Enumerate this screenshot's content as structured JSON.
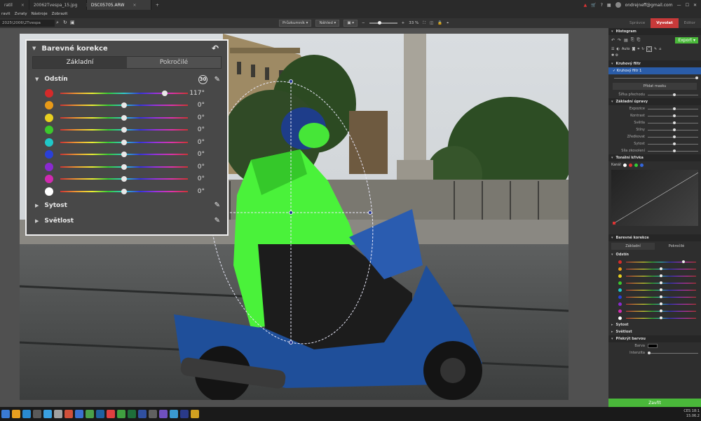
{
  "tabs": [
    {
      "label": "ratil",
      "active": false
    },
    {
      "label": "20062Tvespa_15.jpg",
      "active": false
    },
    {
      "label": "DSC05705.ARW",
      "active": true
    }
  ],
  "user": {
    "email": "ondrejneff@gmail.com"
  },
  "menu": [
    "ravit",
    "Zvraty",
    "Nástroje",
    "Zobrazit"
  ],
  "path": "2025\\2006\\2Tvespa",
  "center_tools": {
    "explorer": "Průzkumník",
    "preview": "Náhled",
    "zoom": "33 %"
  },
  "modes": [
    {
      "label": "Správce",
      "active": false
    },
    {
      "label": "Vyvolat",
      "active": true
    },
    {
      "label": "Editor",
      "active": false
    }
  ],
  "panel": {
    "histogram": "Histogram",
    "auto": "Auto",
    "export": "Export",
    "circular_filter": "Kruhový filtr",
    "filter_item": "Kruhový filtr 1",
    "add_mask": "Přidat masku",
    "transition": "Šířka přechodu",
    "basic": "Základní úpravy",
    "basic_rows": [
      "Expozice",
      "Kontrast",
      "Světla",
      "Stíny",
      "Zředkovat",
      "Sytost",
      "Síla zkosolení"
    ],
    "tone_curve": "Tonální křivka",
    "channel": "Kanál",
    "cc": "Barevné korekce",
    "cc_tabs": [
      "Základní",
      "Pokročilé"
    ],
    "hue": "Odstín",
    "saturation": "Sytost",
    "lightness": "Světlost",
    "cover": "Překrýt barvou",
    "color_label": "Barva",
    "intensity": "Intenzita",
    "close": "Zavřít"
  },
  "overlay": {
    "title": "Barevné korekce",
    "tabs": [
      {
        "label": "Základní",
        "active": true
      },
      {
        "label": "Pokročilé",
        "active": false
      }
    ],
    "hue_section": "Odstín",
    "badge": "30",
    "hues": [
      {
        "color": "#d42a2a",
        "value": "117°",
        "pos": 0.82
      },
      {
        "color": "#e89a18",
        "value": "0°",
        "pos": 0.5
      },
      {
        "color": "#e8d020",
        "value": "0°",
        "pos": 0.5
      },
      {
        "color": "#3cc82c",
        "value": "0°",
        "pos": 0.5
      },
      {
        "color": "#20c8c8",
        "value": "0°",
        "pos": 0.5
      },
      {
        "color": "#2a40d8",
        "value": "0°",
        "pos": 0.5
      },
      {
        "color": "#8a2ad0",
        "value": "0°",
        "pos": 0.5
      },
      {
        "color": "#d02ab0",
        "value": "0°",
        "pos": 0.5
      },
      {
        "color": "#ffffff",
        "value": "0°",
        "pos": 0.5
      }
    ],
    "saturation_section": "Sytost",
    "lightness_section": "Světlost"
  },
  "clock": {
    "time": "18:1",
    "date": "15.06.2"
  },
  "clock_lang": "CES"
}
